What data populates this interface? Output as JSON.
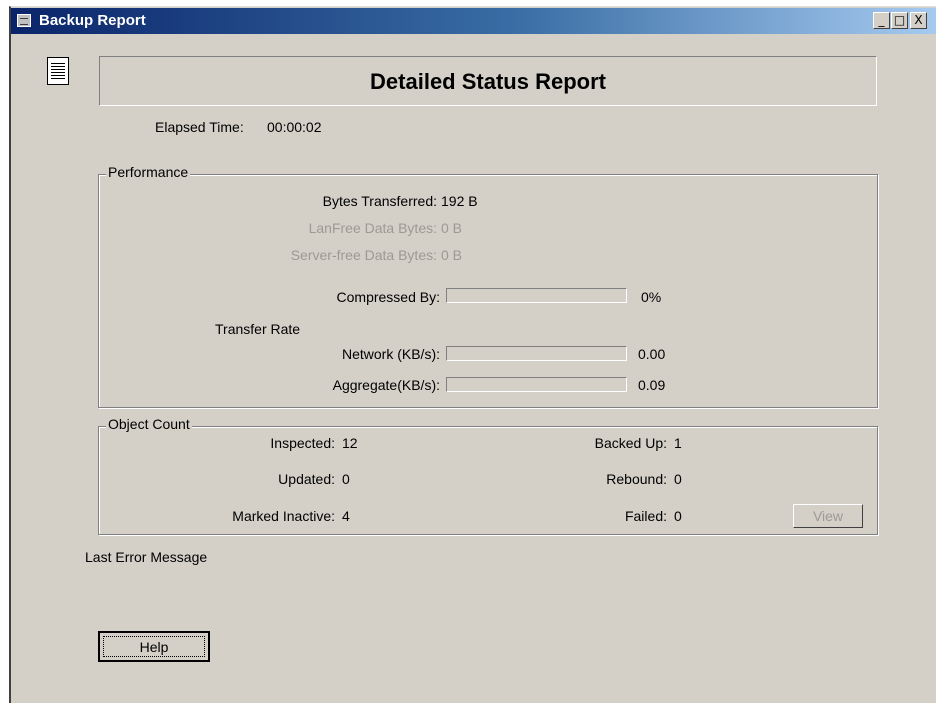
{
  "window": {
    "title": "Backup Report",
    "minimize": "_",
    "maximize": "□",
    "close": "X"
  },
  "header": {
    "title": "Detailed Status Report"
  },
  "elapsed": {
    "label": "Elapsed Time:",
    "value": "00:00:02"
  },
  "performance": {
    "legend": "Performance",
    "bytes_transferred": {
      "label": "Bytes Transferred:",
      "value": "192  B"
    },
    "lanfree_bytes": {
      "label": "LanFree Data Bytes:",
      "value": "0  B"
    },
    "serverfree_bytes": {
      "label": "Server-free Data Bytes:",
      "value": "0  B"
    },
    "compressed": {
      "label": "Compressed By:",
      "value": "0%",
      "progress": 0
    },
    "transfer_rate_label": "Transfer Rate",
    "network": {
      "label": "Network (KB/s):",
      "value": "0.00",
      "progress": 0
    },
    "aggregate": {
      "label": "Aggregate(KB/s):",
      "value": "0.09",
      "progress": 0
    }
  },
  "object_count": {
    "legend": "Object Count",
    "inspected": {
      "label": "Inspected:",
      "value": "12"
    },
    "updated": {
      "label": "Updated:",
      "value": "0"
    },
    "marked_inactive": {
      "label": "Marked Inactive:",
      "value": "4"
    },
    "backed_up": {
      "label": "Backed Up:",
      "value": "1"
    },
    "rebound": {
      "label": "Rebound:",
      "value": "0"
    },
    "failed": {
      "label": "Failed:",
      "value": "0"
    },
    "view_button": "View"
  },
  "last_error": {
    "label": "Last Error Message"
  },
  "help_button": "Help"
}
